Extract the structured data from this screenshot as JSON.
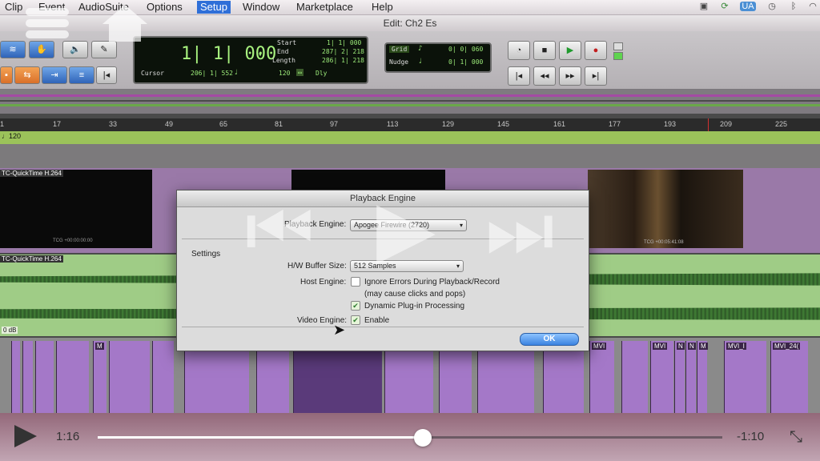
{
  "menubar": {
    "items": [
      "Clip",
      "Event",
      "AudioSuite",
      "Options",
      "Setup",
      "Window",
      "Marketplace",
      "Help"
    ],
    "active_index": 4,
    "icons": [
      "camera-icon",
      "sync-icon",
      "user-badge-icon",
      "time-machine-icon",
      "bluetooth-icon",
      "wifi-icon"
    ]
  },
  "window": {
    "title": "Edit: Ch2 Es"
  },
  "counters": {
    "main": "1| 1| 000",
    "start_label": "Start",
    "start_value": "1| 1| 000",
    "end_label": "End",
    "end_value": "287| 2| 218",
    "length_label": "Length",
    "length_value": "286| 1| 218",
    "cursor_label": "Cursor",
    "cursor_value": "206| 1| 552",
    "tempo_value": "120",
    "dly_label": "Dly",
    "grid_label": "Grid",
    "grid_value": "0| 0| 060",
    "nudge_label": "Nudge",
    "nudge_value": "0| 1| 000"
  },
  "ruler": {
    "ticks": [
      "1",
      "17",
      "33",
      "49",
      "65",
      "81",
      "97",
      "113",
      "129",
      "145",
      "161",
      "177",
      "193",
      "209",
      "225"
    ]
  },
  "tempo_track": {
    "label": "♩120"
  },
  "tracks": {
    "video_clip_label": "TC-QuickTime H.264",
    "video_tc_left": "TCG +00:00:00:00",
    "video_tc_right": "TCG +00:05:41:08",
    "audio_clip_label": "TC-QuickTime H.264",
    "audio_gain": "0 dB",
    "clip_labels": [
      "M",
      "MVI",
      "MVI",
      "N",
      "N",
      "M",
      "MVI_I",
      "MVI_24("
    ]
  },
  "dialog": {
    "title": "Playback Engine",
    "playback_engine_label": "Playback Engine:",
    "playback_engine_value": "Apogee Firewire (2720)",
    "settings_label": "Settings",
    "hw_buffer_label": "H/W Buffer Size:",
    "hw_buffer_value": "512 Samples",
    "host_engine_label": "Host Engine:",
    "ignore_errors_label": "Ignore Errors During Playback/Record",
    "ignore_errors_note": "(may cause clicks and pops)",
    "ignore_errors_checked": false,
    "dynamic_plugin_label": "Dynamic Plug-in Processing",
    "dynamic_plugin_checked": true,
    "video_engine_label": "Video Engine:",
    "video_enable_label": "Enable",
    "video_enable_checked": true,
    "ok_label": "OK"
  },
  "player": {
    "elapsed": "1:16",
    "remaining": "-1:10",
    "progress": 0.521
  }
}
